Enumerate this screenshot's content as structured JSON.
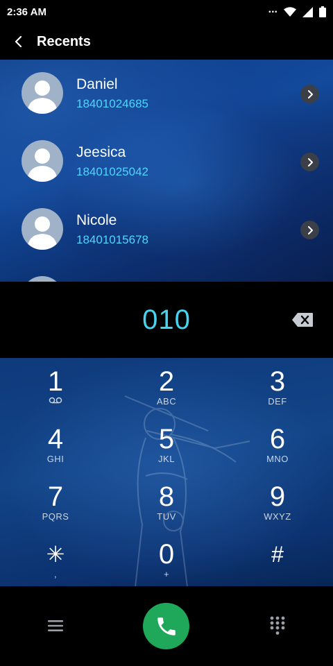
{
  "status_bar": {
    "time": "2:36 AM",
    "more_indicator": "...",
    "icons": [
      "more-dots-icon",
      "wifi-icon",
      "cell-signal-icon",
      "battery-icon"
    ]
  },
  "app_bar": {
    "title": "Recents",
    "back_icon": "back-arrow-icon"
  },
  "recents": [
    {
      "name": "Daniel",
      "number": "18401024685"
    },
    {
      "name": "Jeesica",
      "number": "18401025042"
    },
    {
      "name": "Nicole",
      "number": "18401015678"
    }
  ],
  "dialer": {
    "dialed_number": "010",
    "backspace_icon": "backspace-icon"
  },
  "keypad": [
    {
      "digit": "1",
      "letters": "",
      "icon": "voicemail-icon"
    },
    {
      "digit": "2",
      "letters": "ABC"
    },
    {
      "digit": "3",
      "letters": "DEF"
    },
    {
      "digit": "4",
      "letters": "GHI"
    },
    {
      "digit": "5",
      "letters": "JKL"
    },
    {
      "digit": "6",
      "letters": "MNO"
    },
    {
      "digit": "7",
      "letters": "PQRS"
    },
    {
      "digit": "8",
      "letters": "TUV"
    },
    {
      "digit": "9",
      "letters": "WXYZ"
    },
    {
      "digit": "✳",
      "letters": ","
    },
    {
      "digit": "0",
      "letters": "+"
    },
    {
      "digit": "#",
      "letters": ""
    }
  ],
  "bottom_bar": {
    "menu_icon": "hamburger-menu-icon",
    "call_icon": "phone-icon",
    "keypad_icon": "dialpad-icon"
  },
  "colors": {
    "accent": "#45d3ee",
    "number_text": "#4fd6ff",
    "call_button": "#1fa85a",
    "background": "#000000"
  }
}
